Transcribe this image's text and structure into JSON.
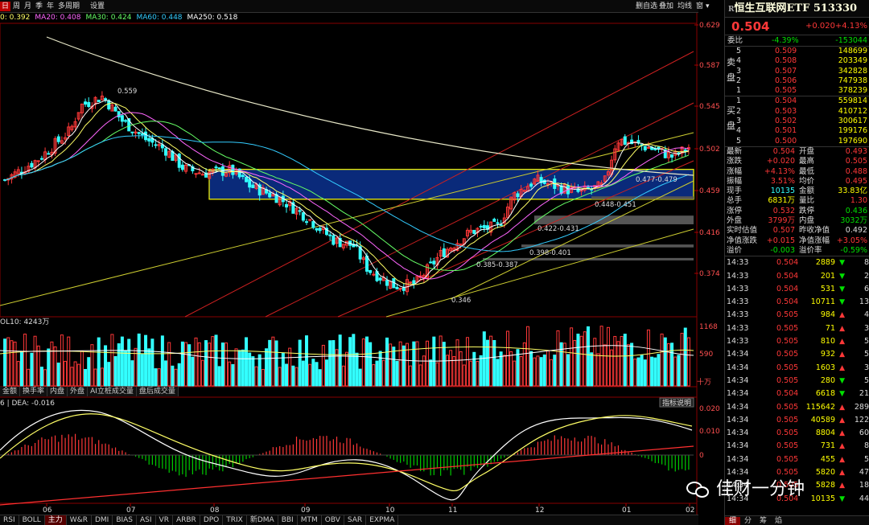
{
  "toolbar": {
    "left": [
      {
        "label": "日",
        "active": true
      },
      {
        "label": "周"
      },
      {
        "label": "月"
      },
      {
        "label": "季"
      },
      {
        "label": "年"
      },
      {
        "label": "多周期"
      },
      {
        "label": "设置"
      }
    ],
    "right": [
      "删自选",
      "叠加",
      "均线",
      "窗",
      "▾"
    ]
  },
  "ma_legend": [
    {
      "text": "0: 0.392",
      "color": "#ffff66"
    },
    {
      "text": "MA20: 0.408",
      "color": "#ff66ff"
    },
    {
      "text": "MA30: 0.424",
      "color": "#66ff66"
    },
    {
      "text": "MA60: 0.448",
      "color": "#33ccff"
    },
    {
      "text": "MA250: 0.518",
      "color": "#ffffff"
    }
  ],
  "price_axis": [
    "0.629",
    "0.587",
    "0.545",
    "0.502",
    "0.459",
    "0.416",
    "0.374"
  ],
  "volume_axis": [
    "1168",
    "590"
  ],
  "volume_unit": "十万",
  "vol_label": "OL10: 4243万",
  "macd_label": "6 | DEA: -0.016",
  "macd_axis": [
    "0.020",
    "0.010",
    "0"
  ],
  "indicator_help": "指标说明",
  "date_axis": [
    "06",
    "07",
    "08",
    "09",
    "10",
    "11",
    "12",
    "01",
    "02"
  ],
  "annotations": [
    "0.559",
    "0.346",
    "0.385-0.387",
    "0.398-0.401",
    "0.422-0.431",
    "0.448-0.451",
    "0.477-0.479"
  ],
  "indicator_tabs": [
    "金额",
    "换手率",
    "内盘",
    "外盘",
    "AI立桩成交量",
    "盘后成交量"
  ],
  "bottom_tabs": [
    "RSI",
    "BOLL",
    "主力",
    "W&R",
    "DMI",
    "BIAS",
    "ASI",
    "VR",
    "ARBR",
    "DPO",
    "TRIX",
    "新DMA",
    "BBI",
    "MTM",
    "OBV",
    "SAR",
    "EXPMA"
  ],
  "quote": {
    "title": "恒生互联网ETF 513330",
    "title_prefix": "R",
    "price": "0.504",
    "change": "+0.020",
    "change_pct": "+4.13%",
    "ratio_label": "委比",
    "ratio_pct": "-4.39%",
    "ratio_diff": "-153044",
    "sell_label": "卖盘",
    "buy_label": "买盘",
    "sells": [
      {
        "lvl": "5",
        "price": "0.509",
        "vol": "148699"
      },
      {
        "lvl": "4",
        "price": "0.508",
        "vol": "203349"
      },
      {
        "lvl": "3",
        "price": "0.507",
        "vol": "342828"
      },
      {
        "lvl": "2",
        "price": "0.506",
        "vol": "747938"
      },
      {
        "lvl": "1",
        "price": "0.505",
        "vol": "378239"
      }
    ],
    "buys": [
      {
        "lvl": "1",
        "price": "0.504",
        "vol": "559814"
      },
      {
        "lvl": "2",
        "price": "0.503",
        "vol": "410712"
      },
      {
        "lvl": "3",
        "price": "0.502",
        "vol": "300617"
      },
      {
        "lvl": "4",
        "price": "0.501",
        "vol": "199176"
      },
      {
        "lvl": "5",
        "price": "0.500",
        "vol": "197690"
      }
    ],
    "stats": [
      {
        "k1": "最新",
        "v1": "0.504",
        "c1": "red",
        "k2": "开盘",
        "v2": "0.493",
        "c2": "red"
      },
      {
        "k1": "涨跌",
        "v1": "+0.020",
        "c1": "red",
        "k2": "最高",
        "v2": "0.505",
        "c2": "red"
      },
      {
        "k1": "涨幅",
        "v1": "+4.13%",
        "c1": "red",
        "k2": "最低",
        "v2": "0.488",
        "c2": "red"
      },
      {
        "k1": "振幅",
        "v1": "3.51%",
        "c1": "red",
        "k2": "均价",
        "v2": "0.495",
        "c2": "red"
      },
      {
        "k1": "现手",
        "v1": "10135",
        "c1": "cyan",
        "k2": "金额",
        "v2": "33.83亿",
        "c2": "yellow"
      },
      {
        "k1": "总手",
        "v1": "6831万",
        "c1": "yellow",
        "k2": "量比",
        "v2": "1.30",
        "c2": "red"
      },
      {
        "k1": "涨停",
        "v1": "0.532",
        "c1": "red",
        "k2": "跌停",
        "v2": "0.436",
        "c2": "green"
      },
      {
        "k1": "外盘",
        "v1": "3799万",
        "c1": "red",
        "k2": "内盘",
        "v2": "3032万",
        "c2": "green"
      },
      {
        "k1": "实时估值",
        "v1": "0.507",
        "c1": "red",
        "k2": "昨收净值",
        "v2": "0.492",
        "c2": "white"
      },
      {
        "k1": "净值涨跌",
        "v1": "+0.015",
        "c1": "red",
        "k2": "净值涨幅",
        "v2": "+3.05%",
        "c2": "red"
      },
      {
        "k1": "溢价",
        "v1": "-0.003",
        "c1": "green",
        "k2": "溢价率",
        "v2": "-0.59%",
        "c2": "green"
      }
    ],
    "ticks": [
      {
        "time": "14:33",
        "price": "0.504",
        "vol": "2889",
        "dir": "down",
        "n": "8"
      },
      {
        "time": "14:33",
        "price": "0.504",
        "vol": "201",
        "dir": "down",
        "n": "2"
      },
      {
        "time": "14:33",
        "price": "0.504",
        "vol": "531",
        "dir": "down",
        "n": "6"
      },
      {
        "time": "14:33",
        "price": "0.504",
        "vol": "10711",
        "dir": "down",
        "n": "13"
      },
      {
        "time": "14:33",
        "price": "0.505",
        "vol": "984",
        "dir": "up",
        "n": "4"
      },
      {
        "time": "14:33",
        "price": "0.505",
        "vol": "71",
        "dir": "up",
        "n": "3"
      },
      {
        "time": "14:33",
        "price": "0.505",
        "vol": "810",
        "dir": "up",
        "n": "5"
      },
      {
        "time": "14:34",
        "price": "0.505",
        "vol": "932",
        "dir": "up",
        "n": "5"
      },
      {
        "time": "14:34",
        "price": "0.505",
        "vol": "1603",
        "dir": "up",
        "n": "3"
      },
      {
        "time": "14:34",
        "price": "0.505",
        "vol": "280",
        "dir": "down",
        "n": "5"
      },
      {
        "time": "14:34",
        "price": "0.504",
        "vol": "6618",
        "dir": "down",
        "n": "21"
      },
      {
        "time": "14:34",
        "price": "0.505",
        "vol": "115642",
        "dir": "up",
        "n": "289"
      },
      {
        "time": "14:34",
        "price": "0.505",
        "vol": "40589",
        "dir": "up",
        "n": "122"
      },
      {
        "time": "14:34",
        "price": "0.505",
        "vol": "8804",
        "dir": "up",
        "n": "60"
      },
      {
        "time": "14:34",
        "price": "0.505",
        "vol": "731",
        "dir": "up",
        "n": "8"
      },
      {
        "time": "14:34",
        "price": "0.505",
        "vol": "455",
        "dir": "up",
        "n": "5"
      },
      {
        "time": "14:34",
        "price": "0.505",
        "vol": "5820",
        "dir": "up",
        "n": "47"
      },
      {
        "time": "14:34",
        "price": "0.505",
        "vol": "5828",
        "dir": "up",
        "n": "18"
      },
      {
        "time": "14:34",
        "price": "0.504",
        "vol": "10135",
        "dir": "down",
        "n": "44"
      }
    ],
    "side_tabs": [
      "细",
      "分",
      "筹",
      "焰"
    ]
  },
  "watermark": "佳财一分钟",
  "colors": {
    "up": "#ff3838",
    "down": "#33ffff",
    "ma5": "#ffffff",
    "ma10": "#ffff66",
    "ma20": "#ff66ff",
    "ma30": "#66ff66",
    "ma60": "#33ccff",
    "ma250": "#e8e8c8",
    "channel_red": "#cc2020",
    "channel_yellow": "#cccc30",
    "box_fill": "#0a2a7a"
  }
}
